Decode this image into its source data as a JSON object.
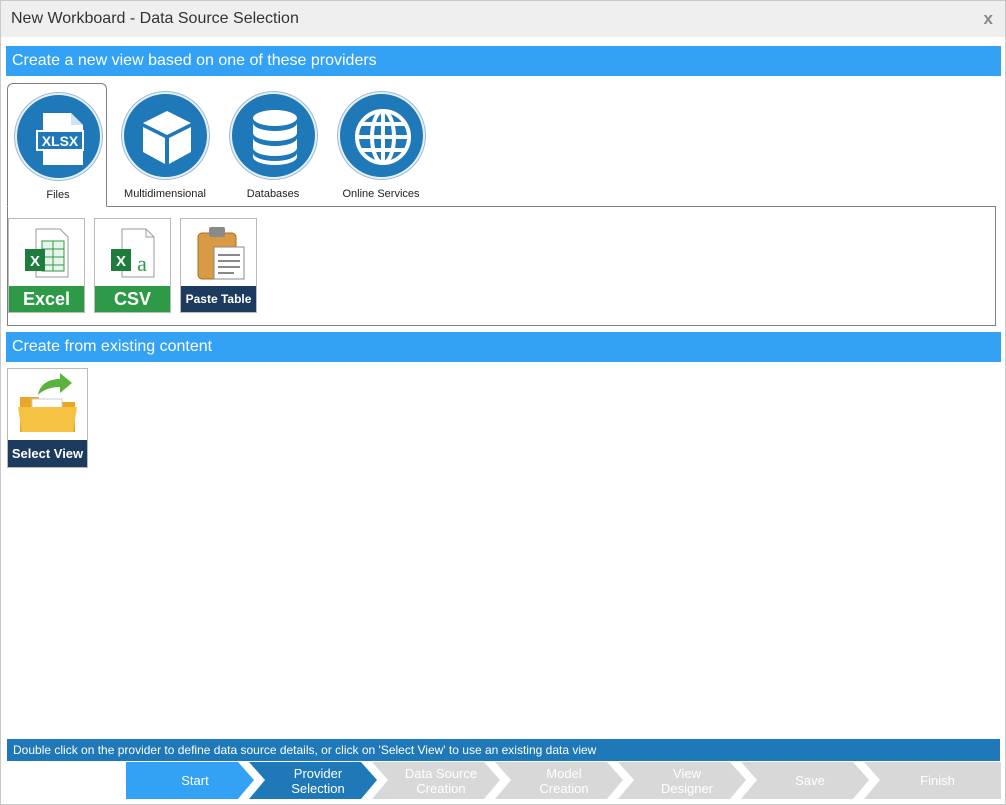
{
  "window": {
    "title": "New Workboard - Data Source Selection",
    "close_label": "x"
  },
  "providers_section": {
    "heading": "Create a new view based on one of these providers",
    "tabs": [
      {
        "label": "Files",
        "icon": "xlsx-file-icon",
        "badge": "XLSX"
      },
      {
        "label": "Multidimensional",
        "icon": "cube-icon"
      },
      {
        "label": "Databases",
        "icon": "database-icon"
      },
      {
        "label": "Online Services",
        "icon": "globe-icon"
      }
    ],
    "file_providers": [
      {
        "label": "Excel",
        "icon": "excel-file-icon"
      },
      {
        "label": "CSV",
        "icon": "csv-file-icon"
      },
      {
        "label": "Paste Table",
        "icon": "clipboard-icon"
      }
    ]
  },
  "existing_section": {
    "heading": "Create from existing content",
    "select_view_label": "Select View",
    "icon": "folder-arrow-icon"
  },
  "status_text": "Double click on the provider to define data source details, or click on 'Select View' to use an existing data view",
  "wizard_steps": [
    {
      "line1": "Start",
      "line2": "",
      "state": "done"
    },
    {
      "line1": "Provider",
      "line2": "Selection",
      "state": "current"
    },
    {
      "line1": "Data Source",
      "line2": "Creation",
      "state": "pending"
    },
    {
      "line1": "Model",
      "line2": "Creation",
      "state": "pending"
    },
    {
      "line1": "View",
      "line2": "Designer",
      "state": "pending"
    },
    {
      "line1": "Save",
      "line2": "",
      "state": "pending"
    },
    {
      "line1": "Finish",
      "line2": "",
      "state": "pending"
    }
  ],
  "colors": {
    "accent": "#33a2f5",
    "dark_blue": "#1f79b8",
    "excel_green": "#2e9a48",
    "navy": "#1d3a5f",
    "pending_step": "#d8d8d8"
  }
}
